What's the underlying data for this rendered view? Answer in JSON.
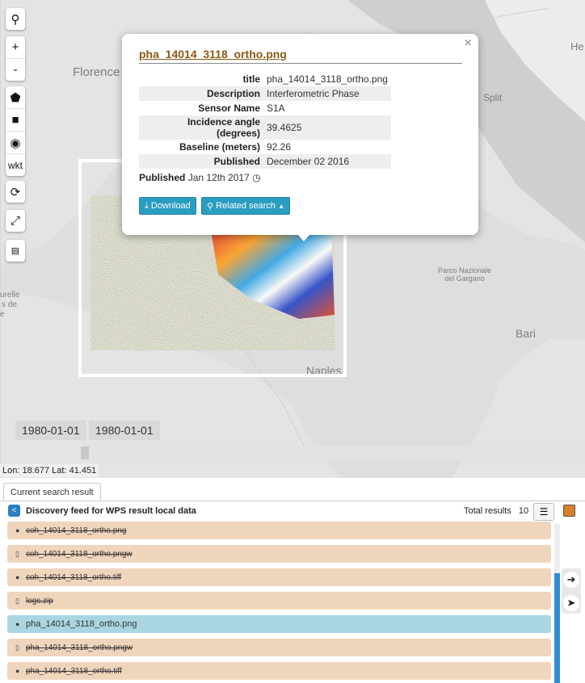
{
  "map": {
    "labels": [
      "Florence",
      "Split",
      "Parco Nazionale del Gargano",
      "Bari",
      "Naples",
      "urelle",
      "s de",
      "e",
      "He"
    ],
    "controls": [
      "search-icon",
      "+",
      "-",
      "polygon-icon",
      "square-icon",
      "marker-icon",
      "wkt",
      "refresh-icon",
      "fullscreen-icon",
      "ruler-icon"
    ]
  },
  "popup": {
    "heading": "pha_14014_3118_ortho.png",
    "close": "×",
    "rows": [
      {
        "key": "title",
        "value": "pha_14014_3118_ortho.png"
      },
      {
        "key": "Description",
        "value": "Interferometric Phase"
      },
      {
        "key": "Sensor Name",
        "value": "S1A"
      },
      {
        "key": "Incidence angle (degrees)",
        "value": "39.4625"
      },
      {
        "key": "Baseline (meters)",
        "value": "92.26"
      },
      {
        "key": "Published",
        "value": "December 02 2016"
      }
    ],
    "published_label": "Published",
    "published_value": "Jan 12th 2017",
    "download": "Download",
    "related": "Related search"
  },
  "timeline": {
    "start": "1980-01-01",
    "end": "1980-01-01"
  },
  "coords": "Lon: 18.677 Lat: 41.451",
  "panel": {
    "tab": "Current search result",
    "feed_title": "Discovery feed for WPS result local data",
    "total_label": "Total results",
    "total_value": "10",
    "items": [
      {
        "icon": "globe-icon",
        "glyph": "●",
        "label": "coh_14014_3118_ortho.png",
        "strike": true,
        "selected": false
      },
      {
        "icon": "file-icon",
        "glyph": "▯",
        "label": "coh_14014_3118_ortho.pngw",
        "strike": true,
        "selected": false
      },
      {
        "icon": "globe-icon",
        "glyph": "●",
        "label": "coh_14014_3118_ortho.tiff",
        "strike": true,
        "selected": false
      },
      {
        "icon": "file-icon",
        "glyph": "▯",
        "label": "logs.zip",
        "strike": true,
        "selected": false
      },
      {
        "icon": "globe-icon",
        "glyph": "●",
        "label": "pha_14014_3118_ortho.png",
        "strike": false,
        "selected": true
      },
      {
        "icon": "file-icon",
        "glyph": "▯",
        "label": "pha_14014_3118_ortho.pngw",
        "strike": true,
        "selected": false
      },
      {
        "icon": "globe-icon",
        "glyph": "●",
        "label": "pha_14014_3118_ortho.tiff",
        "strike": true,
        "selected": false
      }
    ],
    "accent_color": "#d8802d"
  }
}
